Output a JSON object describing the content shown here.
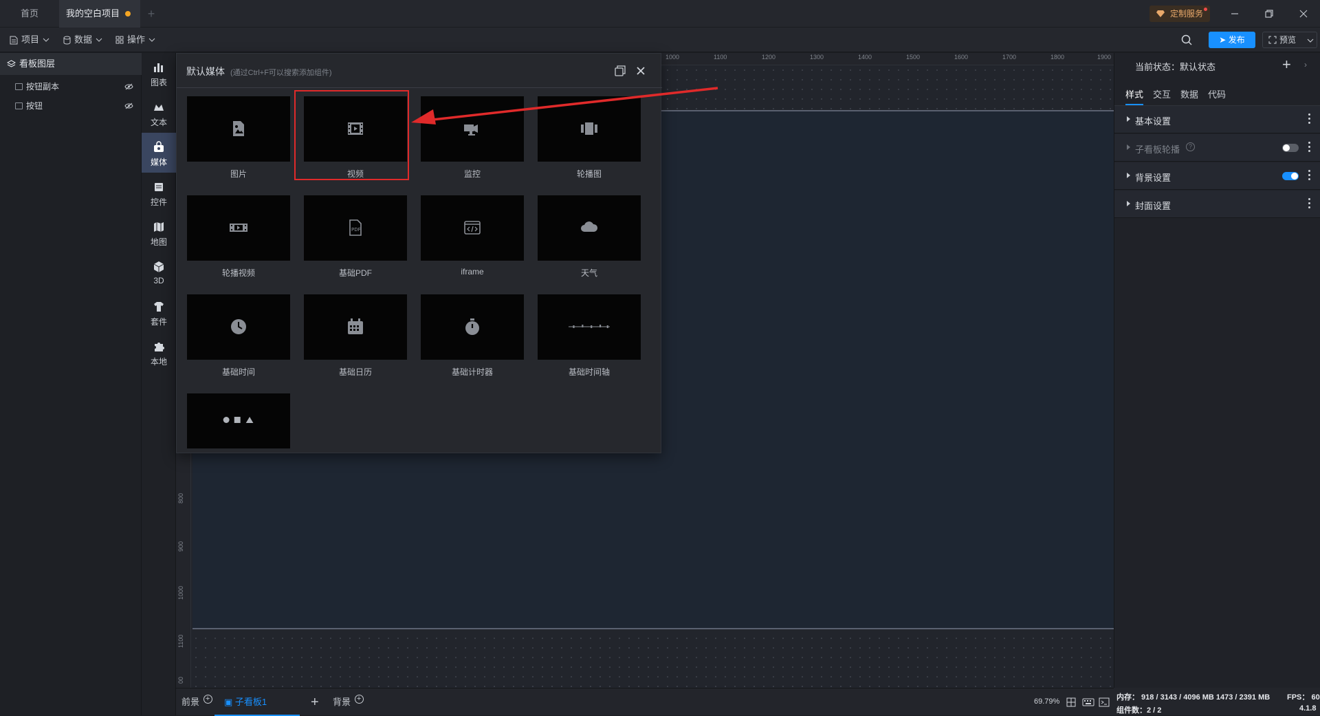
{
  "tabs": {
    "home": "首页",
    "project": "我的空白项目"
  },
  "header": {
    "custom_service": "定制服务"
  },
  "toolbar": {
    "project": "项目",
    "data": "数据",
    "operate": "操作",
    "publish": "发布",
    "preview": "预览"
  },
  "layers": {
    "title": "看板图层",
    "items": [
      {
        "label": "按钮副本"
      },
      {
        "label": "按钮"
      }
    ]
  },
  "categories": [
    {
      "label": "图表",
      "icon": "chart-icon"
    },
    {
      "label": "文本",
      "icon": "text-icon"
    },
    {
      "label": "媒体",
      "icon": "media-icon"
    },
    {
      "label": "控件",
      "icon": "control-icon"
    },
    {
      "label": "地图",
      "icon": "map-icon"
    },
    {
      "label": "3D",
      "icon": "cube-icon"
    },
    {
      "label": "套件",
      "icon": "kit-icon"
    },
    {
      "label": "本地",
      "icon": "puzzle-icon"
    }
  ],
  "popup": {
    "title": "默认媒体",
    "hint": "(通过Ctrl+F可以搜索添加组件)",
    "items": [
      {
        "label": "图片",
        "icon": "image-icon"
      },
      {
        "label": "视频",
        "icon": "film-icon"
      },
      {
        "label": "监控",
        "icon": "camera-icon"
      },
      {
        "label": "轮播图",
        "icon": "carousel-icon"
      },
      {
        "label": "轮播视频",
        "icon": "film-strip-icon"
      },
      {
        "label": "基础PDF",
        "icon": "pdf-icon"
      },
      {
        "label": "iframe",
        "icon": "code-window-icon"
      },
      {
        "label": "天气",
        "icon": "cloud-icon"
      },
      {
        "label": "基础时间",
        "icon": "clock-icon"
      },
      {
        "label": "基础日历",
        "icon": "calendar-icon"
      },
      {
        "label": "基础计时器",
        "icon": "stopwatch-icon"
      },
      {
        "label": "基础时间轴",
        "icon": "timeline-icon"
      },
      {
        "label": "",
        "icon": "shapes-icon"
      }
    ]
  },
  "ruler": {
    "top": [
      "1000",
      "1100",
      "1200",
      "1300",
      "1400",
      "1500",
      "1600",
      "1700",
      "1800",
      "1900"
    ],
    "left": [
      "800",
      "900",
      "1000",
      "1100",
      "00"
    ]
  },
  "bottom": {
    "foreground": "前景",
    "subboard": "子看板1",
    "background": "背景",
    "zoom": "69.79%"
  },
  "right_panel": {
    "state_label": "当前状态：默认状态",
    "tabs": [
      "样式",
      "交互",
      "数据",
      "代码"
    ],
    "sections": [
      {
        "label": "基本设置",
        "toggle": null
      },
      {
        "label": "子看板轮播",
        "toggle": "off"
      },
      {
        "label": "背景设置",
        "toggle": "on"
      },
      {
        "label": "封面设置",
        "toggle": null
      }
    ]
  },
  "status": {
    "memory": "内存： 918 / 3143 / 4096 MB  1473 / 2391 MB",
    "fps": "FPS： 60",
    "components": "组件数：2 / 2",
    "version": "4.1.8"
  },
  "colors": {
    "accent": "#1890ff",
    "highlight": "#e02a2a",
    "warning_dot": "#f5a623"
  }
}
